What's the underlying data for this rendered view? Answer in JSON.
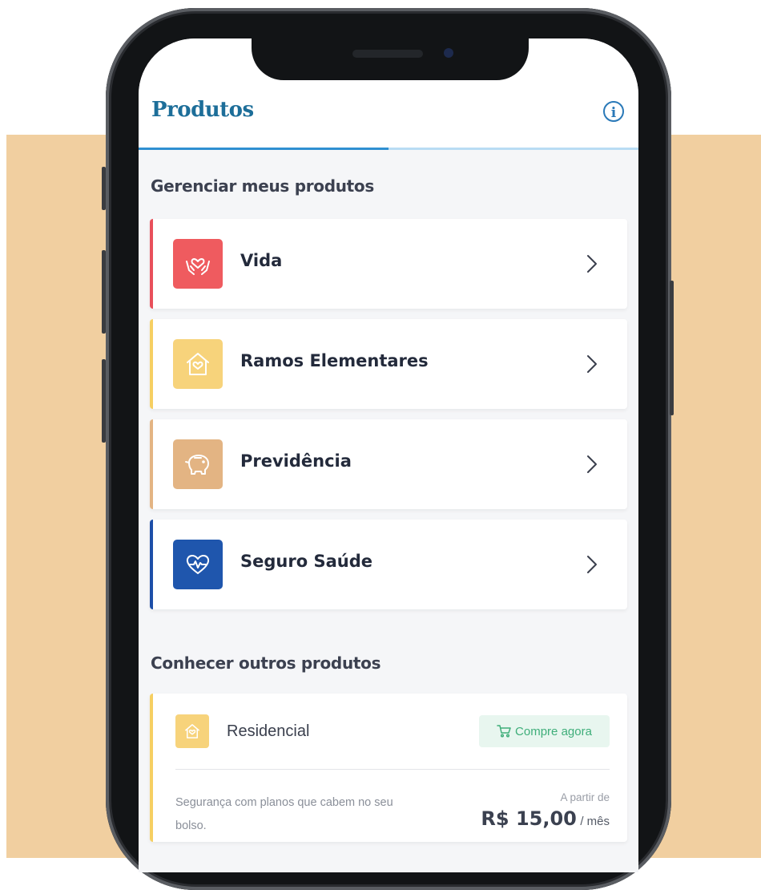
{
  "header": {
    "title": "Produtos",
    "info_icon_glyph": "i"
  },
  "manage_section": {
    "title": "Gerenciar meus produtos",
    "items": [
      {
        "label": "Vida",
        "icon": "heart-hands-icon",
        "accent": "#e8505b",
        "icon_bg": "#ef5b5f"
      },
      {
        "label": "Ramos Elementares",
        "icon": "home-heart-icon",
        "accent": "#f6cf62",
        "icon_bg": "#f7d37b"
      },
      {
        "label": "Previdência",
        "icon": "piggy-bank-icon",
        "accent": "#e3b483",
        "icon_bg": "#e3b483"
      },
      {
        "label": "Seguro Saúde",
        "icon": "heart-pulse-icon",
        "accent": "#1d4fa8",
        "icon_bg": "#1f56ad"
      }
    ]
  },
  "discover_section": {
    "title": "Conhecer outros produtos",
    "offer": {
      "title": "Residencial",
      "icon": "home-heart-icon",
      "buy_label": "Compre agora",
      "description": "Segurança com planos que cabem no seu bolso.",
      "price_prefix": "A partir de",
      "price": "R$ 15,00",
      "price_suffix": "/ mês"
    }
  },
  "colors": {
    "brand_title": "#1d6e99",
    "background_band": "#f1cfa0",
    "buy_accent": "#3fae7a"
  }
}
